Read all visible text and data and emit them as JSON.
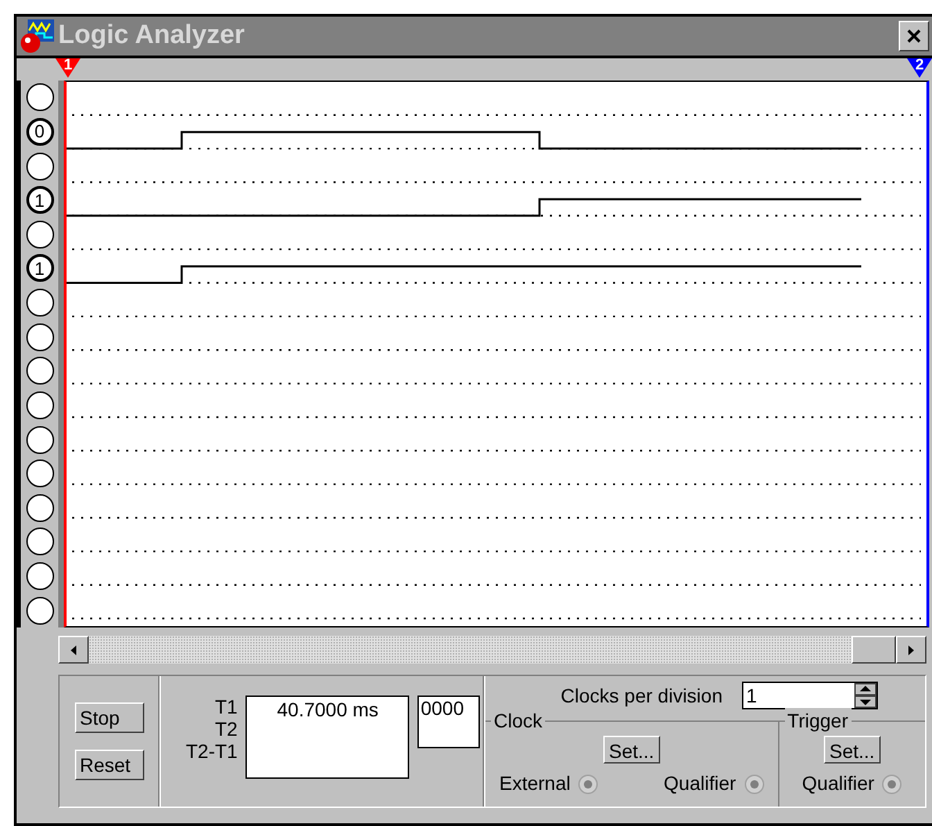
{
  "window": {
    "title": "Logic Analyzer"
  },
  "cursors": [
    {
      "label": "1",
      "color": "#ff0000"
    },
    {
      "label": "2",
      "color": "#0000ff"
    }
  ],
  "channels": [
    {
      "active": false
    },
    {
      "active": true,
      "label": "0"
    },
    {
      "active": false
    },
    {
      "active": true,
      "label": "1"
    },
    {
      "active": false
    },
    {
      "active": true,
      "label": "1"
    },
    {
      "active": false
    },
    {
      "active": false
    },
    {
      "active": false
    },
    {
      "active": false
    },
    {
      "active": false
    },
    {
      "active": false
    },
    {
      "active": false
    },
    {
      "active": false
    },
    {
      "active": false
    },
    {
      "active": false
    }
  ],
  "buttons": [
    "Stop",
    "Reset"
  ],
  "time_readout": {
    "labels": [
      "T1",
      "T2",
      "T2-T1"
    ],
    "values": [
      "40.7000 ms"
    ],
    "count": "0000"
  },
  "clocks_per_division": {
    "label": "Clocks per division",
    "value": "1"
  },
  "clock": {
    "title": "Clock",
    "set_button": "Set...",
    "options": [
      {
        "label": "External",
        "disabled": true
      },
      {
        "label": "Qualifier",
        "disabled": true
      }
    ]
  },
  "trigger": {
    "title": "Trigger",
    "set_button": "Set...",
    "options": [
      {
        "label": "Qualifier",
        "disabled": true
      }
    ]
  }
}
